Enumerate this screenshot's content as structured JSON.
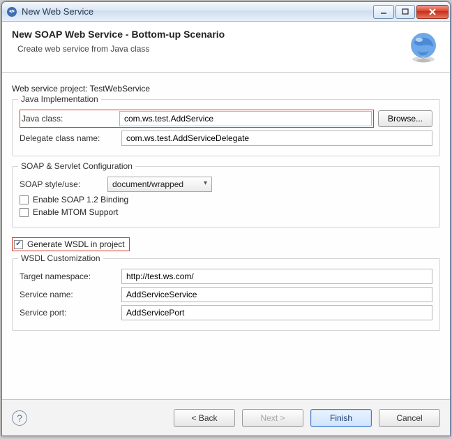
{
  "window": {
    "title": "New Web Service"
  },
  "header": {
    "title": "New SOAP Web Service - Bottom-up Scenario",
    "subtitle": "Create web service from Java class"
  },
  "project_line": {
    "label": "Web service project:",
    "value": "TestWebService"
  },
  "java_impl": {
    "group_title": "Java Implementation",
    "java_class_label": "Java class:",
    "java_class_value": "com.ws.test.AddService",
    "browse_label": "Browse...",
    "delegate_label": "Delegate class name:",
    "delegate_value": "com.ws.test.AddServiceDelegate"
  },
  "soap": {
    "group_title": "SOAP & Servlet Configuration",
    "style_label": "SOAP style/use:",
    "style_value": "document/wrapped",
    "soap12_label": "Enable SOAP 1.2 Binding",
    "mtom_label": "Enable MTOM Support"
  },
  "generate_wsdl_label": "Generate WSDL in project",
  "wsdl": {
    "group_title": "WSDL Customization",
    "ns_label": "Target namespace:",
    "ns_value": "http://test.ws.com/",
    "service_name_label": "Service name:",
    "service_name_value": "AddServiceService",
    "service_port_label": "Service port:",
    "service_port_value": "AddServicePort"
  },
  "buttons": {
    "back": "< Back",
    "next": "Next >",
    "finish": "Finish",
    "cancel": "Cancel"
  }
}
